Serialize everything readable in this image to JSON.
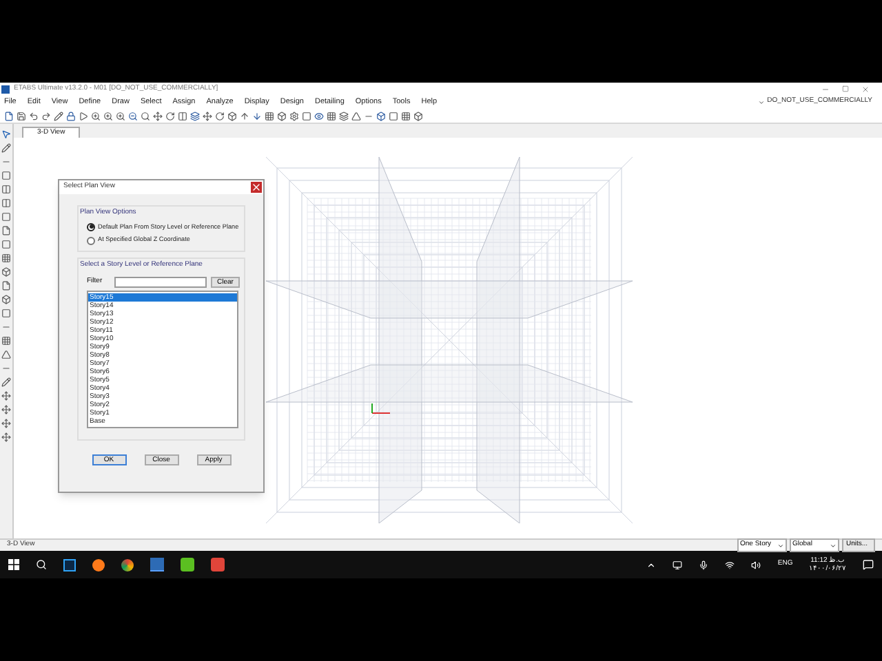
{
  "window": {
    "title": "ETABS Ultimate v13.2.0 - M01  [DO_NOT_USE_COMMERCIALLY]"
  },
  "menu": [
    "File",
    "Edit",
    "View",
    "Define",
    "Draw",
    "Select",
    "Assign",
    "Analyze",
    "Display",
    "Design",
    "Detailing",
    "Options",
    "Tools",
    "Help"
  ],
  "license": "DO_NOT_USE_COMMERCIALLY",
  "tabs": [
    {
      "label": "3-D View",
      "selected": true
    }
  ],
  "dialog": {
    "title": "Select Plan View",
    "options_group": "Plan View Options",
    "options": [
      {
        "label": "Default Plan From Story Level or Reference Plane",
        "selected": true
      },
      {
        "label": "At Specified Global Z Coordinate",
        "selected": false
      }
    ],
    "list_group": "Select a Story Level or Reference Plane",
    "filter_label": "Filter",
    "clear": "Clear",
    "stories": [
      {
        "label": "Story15",
        "selected": true
      },
      {
        "label": "Story14",
        "selected": false
      },
      {
        "label": "Story13",
        "selected": false
      },
      {
        "label": "Story12",
        "selected": false
      },
      {
        "label": "Story11",
        "selected": false
      },
      {
        "label": "Story10",
        "selected": false
      },
      {
        "label": "Story9",
        "selected": false
      },
      {
        "label": "Story8",
        "selected": false
      },
      {
        "label": "Story7",
        "selected": false
      },
      {
        "label": "Story6",
        "selected": false
      },
      {
        "label": "Story5",
        "selected": false
      },
      {
        "label": "Story4",
        "selected": false
      },
      {
        "label": "Story3",
        "selected": false
      },
      {
        "label": "Story2",
        "selected": false
      },
      {
        "label": "Story1",
        "selected": false
      },
      {
        "label": "Base",
        "selected": false
      }
    ],
    "buttons": [
      "OK",
      "Close",
      "Apply"
    ]
  },
  "status_bar": {
    "text": "3-D View",
    "story_mode": "One Story",
    "coord": "Global",
    "units": "Units..."
  },
  "taskbar": {
    "language": "ENG",
    "time": "11:12 ب.ظ",
    "date": "۱۴۰۰/۰۶/۲۷"
  }
}
